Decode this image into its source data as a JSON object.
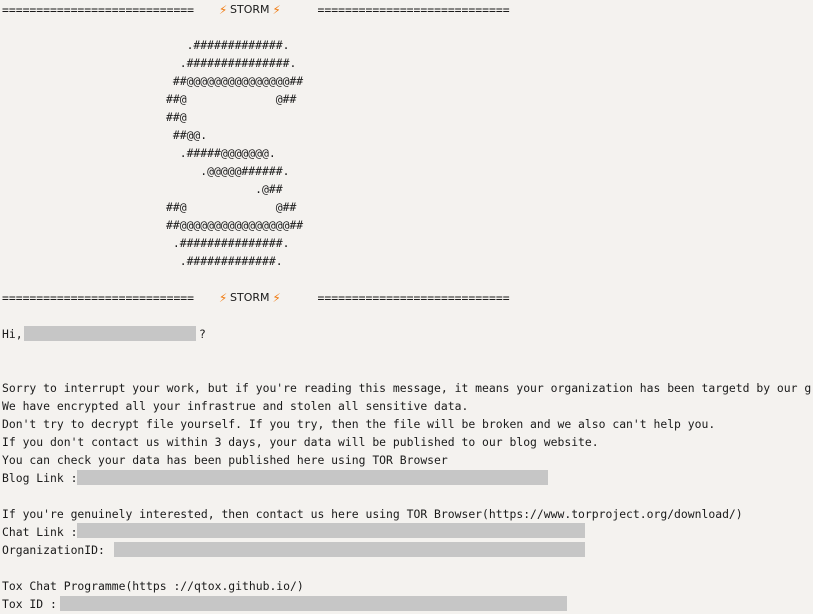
{
  "header": {
    "bar_left": "============================",
    "title": "STORM",
    "bar_right": "============================",
    "bolt_color": "#f07a10"
  },
  "art": {
    "lines": [
      "   .#############.",
      "  .###############.",
      " ##@@@@@@@@@@@@@@@##",
      "##@             @##",
      "##@",
      " ##@@.",
      "  .#####@@@@@@@.",
      "     .@@@@@######.",
      "             .@##",
      "##@             @##",
      "##@@@@@@@@@@@@@@@@##",
      " .###############.",
      "  .#############."
    ]
  },
  "greeting": {
    "prefix": "Hi,",
    "suffix": "?"
  },
  "message": {
    "line1": "Sorry to interrupt your work, but if you're reading this message, it means your organization has been targetd by our group.",
    "line2": "We have encrypted all your infrastrue and stolen all sensitive data.",
    "line3": "Don't try to decrypt file yourself. If you try, then the file will be broken and we also can't help you.",
    "line4": "If you don't contact us within 3 days, your data will be published to our blog website.",
    "line5": "You can check your data has been published here using TOR Browser",
    "blog_label": "Blog Link :",
    "interest_line": "If you're genuinely interested, then contact us here using TOR Browser(https://www.torproject.org/download/)",
    "chat_label": "Chat Link :",
    "org_label": "OrganizationID:",
    "tox_line": "Tox Chat Programme(https ://qtox.github.io/)",
    "tox_label": "Tox ID :"
  },
  "colors": {
    "background": "#f4f2ef",
    "redaction": "#c6c6c6"
  }
}
